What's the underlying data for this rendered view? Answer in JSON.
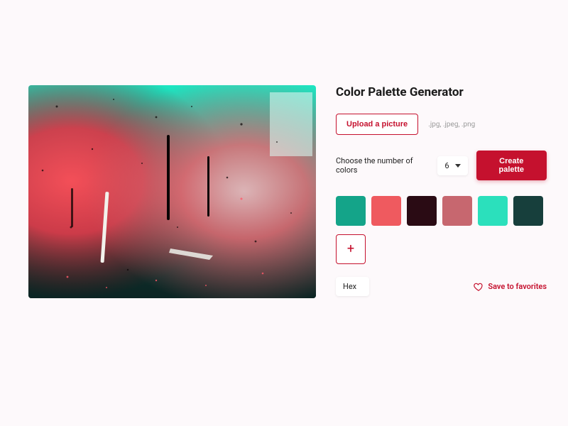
{
  "title": "Color Palette Generator",
  "upload": {
    "button_label": "Upload a picture",
    "hint": ".jpg, .jpeg, .png"
  },
  "count": {
    "label": "Choose the number of colors",
    "value": "6"
  },
  "create_label": "Create palette",
  "palette": [
    "#14a489",
    "#ef5a5f",
    "#2a0b14",
    "#c7676f",
    "#2be0bc",
    "#173f3c"
  ],
  "format": {
    "value": "Hex"
  },
  "save_label": "Save to favorites",
  "accent": "#c5112e"
}
